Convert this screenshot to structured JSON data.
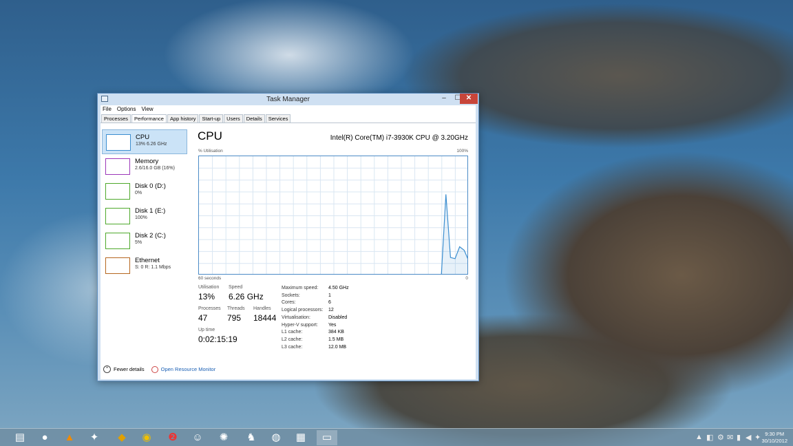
{
  "window": {
    "title": "Task Manager",
    "min_glyph": "–",
    "max_glyph": "☐",
    "close_glyph": "✕"
  },
  "menu": [
    "File",
    "Options",
    "View"
  ],
  "tabs": [
    "Processes",
    "Performance",
    "App history",
    "Start-up",
    "Users",
    "Details",
    "Services"
  ],
  "active_tab": "Performance",
  "sidebar": {
    "items": [
      {
        "name": "CPU",
        "value": "13% 6.26 GHz",
        "color": "#3b8ed0"
      },
      {
        "name": "Memory",
        "value": "2.6/16.0 GB (16%)",
        "color": "#9b36b8"
      },
      {
        "name": "Disk 0 (D:)",
        "value": "0%",
        "color": "#4da82a"
      },
      {
        "name": "Disk 1 (E:)",
        "value": "100%",
        "color": "#4da82a"
      },
      {
        "name": "Disk 2 (C:)",
        "value": "5%",
        "color": "#4da82a"
      },
      {
        "name": "Ethernet",
        "value": "S: 0 R: 1.1 Mbps",
        "color": "#b5651d"
      }
    ]
  },
  "main": {
    "heading": "CPU",
    "model": "Intel(R) Core(TM) i7-3930K CPU @ 3.20GHz",
    "util_label": "% Utilisation",
    "max_label": "100%",
    "time_label": "60 seconds",
    "min_label": "0"
  },
  "stats": {
    "utilisation_label": "Utilisation",
    "utilisation": "13%",
    "speed_label": "Speed",
    "speed": "6.26 GHz",
    "processes_label": "Processes",
    "processes": "47",
    "threads_label": "Threads",
    "threads": "795",
    "handles_label": "Handles",
    "handles": "18444",
    "uptime_label": "Up time",
    "uptime": "0:02:15:19"
  },
  "details": [
    {
      "k": "Maximum speed:",
      "v": "4.50 GHz"
    },
    {
      "k": "Sockets:",
      "v": "1"
    },
    {
      "k": "Cores:",
      "v": "6"
    },
    {
      "k": "Logical processors:",
      "v": "12"
    },
    {
      "k": "Virtualisation:",
      "v": "Disabled"
    },
    {
      "k": "Hyper-V support:",
      "v": "Yes"
    },
    {
      "k": "L1 cache:",
      "v": "384 KB"
    },
    {
      "k": "L2 cache:",
      "v": "1.5 MB"
    },
    {
      "k": "L3 cache:",
      "v": "12.0 MB"
    }
  ],
  "footer": {
    "fewer_details": "Fewer details",
    "resource_monitor": "Open Resource Monitor"
  },
  "cpu_history": [
    0,
    0,
    0,
    0,
    0,
    0,
    0,
    0,
    0,
    0,
    0,
    0,
    0,
    0,
    0,
    0,
    0,
    0,
    0,
    0,
    0,
    0,
    0,
    0,
    0,
    0,
    0,
    0,
    0,
    0,
    0,
    0,
    0,
    0,
    0,
    0,
    0,
    0,
    0,
    0,
    0,
    0,
    0,
    0,
    0,
    0,
    0,
    0,
    0,
    0,
    0,
    0,
    0,
    0,
    68,
    15,
    14,
    24,
    21,
    12
  ],
  "taskbar": {
    "icons": [
      "explorer-icon",
      "firefox-icon",
      "vlc-icon",
      "game-icon",
      "diablo-icon",
      "wow-icon",
      "2-icon",
      "character-icon",
      "spider-icon",
      "soldier-icon",
      "network-icon",
      "winrar-icon",
      "task-manager-icon"
    ],
    "tray": [
      "▲",
      "◧",
      "⚙",
      "✉",
      "▮",
      "◀",
      "✦"
    ],
    "time": "9:30 PM",
    "date": "30/10/2012"
  }
}
